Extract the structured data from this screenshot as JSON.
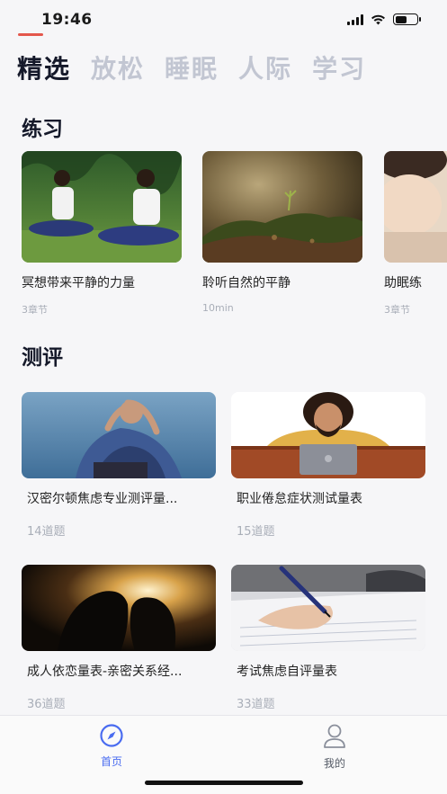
{
  "status": {
    "time": "19:46",
    "battery_level": 0.55
  },
  "top_tabs": [
    {
      "label": "精选",
      "active": true
    },
    {
      "label": "放松",
      "active": false
    },
    {
      "label": "睡眠",
      "active": false
    },
    {
      "label": "人际",
      "active": false
    },
    {
      "label": "学习",
      "active": false
    }
  ],
  "practice": {
    "title": "练习",
    "items": [
      {
        "title": "冥想带来平静的力量",
        "meta": "3章节"
      },
      {
        "title": "聆听自然的平静",
        "meta": "10min"
      },
      {
        "title": "助眠练",
        "meta": "3章节"
      }
    ]
  },
  "assessment": {
    "title": "测评",
    "items": [
      {
        "title": "汉密尔顿焦虑专业测评量...",
        "meta": "14道题"
      },
      {
        "title": "职业倦怠症状测试量表",
        "meta": "15道题"
      },
      {
        "title": "成人依恋量表-亲密关系经...",
        "meta": "36道题"
      },
      {
        "title": "考试焦虑自评量表",
        "meta": "33道题"
      }
    ]
  },
  "bottom_nav": {
    "home_label": "首页",
    "profile_label": "我的"
  },
  "colors": {
    "accent": "#4a6cf0",
    "tab_underline": "#e4574c",
    "inactive_tab": "#c2c6d2"
  }
}
